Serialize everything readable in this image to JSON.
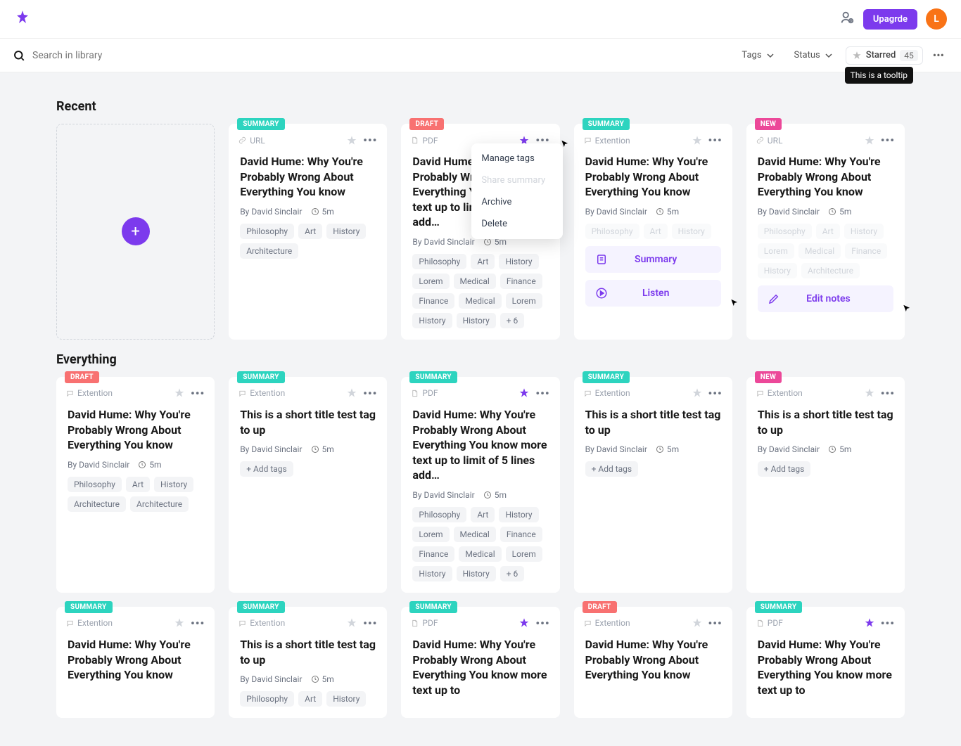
{
  "topbar": {
    "upgrade_label": "Upagrde",
    "avatar_initial": "L"
  },
  "search": {
    "placeholder": "Search in library"
  },
  "filters": {
    "tags_label": "Tags",
    "status_label": "Status",
    "starred_label": "Starred",
    "starred_count": "45",
    "tooltip": "This is a tooltip"
  },
  "sections": {
    "recent": "Recent",
    "everything": "Everything"
  },
  "source": {
    "url": "URL",
    "pdf": "PDF",
    "extention": "Extention"
  },
  "badges": {
    "summary": "SUMMARY",
    "draft": "DRAFT",
    "new": "NEW"
  },
  "common": {
    "title_long": "David Hume: Why You're Probably Wrong About Everything You know",
    "title_longer": "David Hume: Why You're Probably Wrong About Everything You know more text up to limit of 5 lines add…",
    "title_longer2": "David Hume: Why You're Probably Wrong About Everything You know more text up to",
    "title_short": "This is a short title test tag to up",
    "author": "By David Sinclair",
    "duration": "5m",
    "add_tags": "+ Add tags",
    "more_tags": "+ 6"
  },
  "tags4": [
    "Philosophy",
    "Art",
    "History",
    "Architecture"
  ],
  "tags4b": [
    "Philosophy",
    "Art",
    "History",
    "Architecture",
    "Architecture"
  ],
  "tags_many": [
    "Philosophy",
    "Art",
    "History",
    "Lorem",
    "Medical",
    "Finance",
    "Finance",
    "Medical",
    "Lorem",
    "History",
    "History"
  ],
  "tags_faded": [
    "Philosophy",
    "Art",
    "History",
    "Lorem",
    "Medical",
    "Finance",
    "History",
    "Architecture"
  ],
  "tags3": [
    "Philosophy",
    "Art",
    "History"
  ],
  "menu": {
    "manage": "Manage tags",
    "share": "Share summary",
    "archive": "Archive",
    "delete": "Delete"
  },
  "actions": {
    "summary": "Summary",
    "listen": "Listen",
    "edit": "Edit notes"
  }
}
